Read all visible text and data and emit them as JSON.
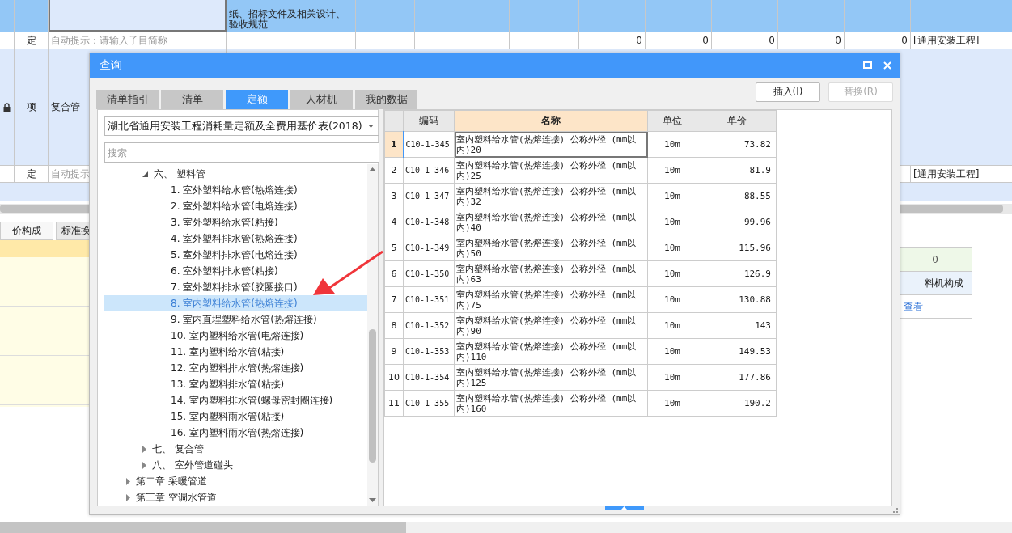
{
  "sheet": {
    "rows": [
      {
        "kind": "description",
        "selected": true,
        "text": "纸、招标文件及相关设计、验收规范"
      },
      {
        "kind": "sub",
        "type": "定",
        "placeholder": "自动提示：请输入子目简称",
        "values": [
          "0",
          "0",
          "0",
          "0",
          "0"
        ],
        "category": "[通用安装工程]"
      },
      {
        "kind": "item",
        "locked": true,
        "type": "项",
        "name": "复合管"
      },
      {
        "kind": "sub",
        "type": "定",
        "placeholder": "自动提示",
        "category": "[通用安装工程]"
      },
      {
        "kind": "blank"
      }
    ]
  },
  "lower_tabs": [
    {
      "label": "价构成",
      "selected": true
    },
    {
      "label": "标准换",
      "selected": false
    }
  ],
  "side_box": {
    "value": "0",
    "header": "料机构成",
    "link": "查看"
  },
  "dialog": {
    "title": "查询",
    "tabs": [
      {
        "label": "清单指引",
        "selected": false
      },
      {
        "label": "清单",
        "selected": false
      },
      {
        "label": "定额",
        "selected": true
      },
      {
        "label": "人材机",
        "selected": false
      },
      {
        "label": "我的数据",
        "selected": false
      }
    ],
    "buttons": [
      {
        "label": "插入(I)",
        "disabled": false
      },
      {
        "label": "替换(R)",
        "disabled": true
      }
    ],
    "library": "湖北省通用安装工程消耗量定额及全费用基价表(2018)",
    "search": {
      "placeholder": "搜索"
    },
    "tree": [
      {
        "children": [
          {
            "label": "六、 塑料管",
            "expanded": true,
            "selected": false,
            "children": [
              {
                "label": "1. 室外塑料给水管(热熔连接)",
                "selected": false
              },
              {
                "label": "2. 室外塑料给水管(电熔连接)",
                "selected": false
              },
              {
                "label": "3. 室外塑料给水管(粘接)",
                "selected": false
              },
              {
                "label": "4. 室外塑料排水管(热熔连接)",
                "selected": false
              },
              {
                "label": "5. 室外塑料排水管(电熔连接)",
                "selected": false
              },
              {
                "label": "6. 室外塑料排水管(粘接)",
                "selected": false
              },
              {
                "label": "7. 室外塑料排水管(胶圈接口)",
                "selected": false
              },
              {
                "label": "8. 室内塑料给水管(热熔连接)",
                "selected": true
              },
              {
                "label": "9. 室内直埋塑料给水管(热熔连接)",
                "selected": false
              },
              {
                "label": "10. 室内塑料给水管(电熔连接)",
                "selected": false
              },
              {
                "label": "11. 室内塑料给水管(粘接)",
                "selected": false
              },
              {
                "label": "12. 室内塑料排水管(热熔连接)",
                "selected": false
              },
              {
                "label": "13. 室内塑料排水管(粘接)",
                "selected": false
              },
              {
                "label": "14. 室内塑料排水管(螺母密封圈连接)",
                "selected": false
              },
              {
                "label": "15. 室内塑料雨水管(粘接)",
                "selected": false
              },
              {
                "label": "16. 室内塑料雨水管(热熔连接)",
                "selected": false
              }
            ]
          },
          {
            "label": "七、 复合管",
            "expanded": false,
            "selected": false
          },
          {
            "label": "八、 室外管道碰头",
            "expanded": false,
            "selected": false
          }
        ]
      },
      {
        "label": "第二章 采暖管道",
        "expanded": false,
        "selected": false
      },
      {
        "label": "第三章 空调水管道",
        "expanded": false,
        "selected": false
      }
    ],
    "table": {
      "columns": [
        "编码",
        "名称",
        "单位",
        "单价"
      ],
      "rows": [
        {
          "index": "1",
          "code": "C10-1-345",
          "name": "室内塑料给水管(热熔连接) 公称外径 (mm以内)20",
          "unit": "10m",
          "price": "73.82",
          "selected": true
        },
        {
          "index": "2",
          "code": "C10-1-346",
          "name": "室内塑料给水管(热熔连接) 公称外径 (mm以内)25",
          "unit": "10m",
          "price": "81.9",
          "selected": false
        },
        {
          "index": "3",
          "code": "C10-1-347",
          "name": "室内塑料给水管(热熔连接) 公称外径 (mm以内)32",
          "unit": "10m",
          "price": "88.55",
          "selected": false
        },
        {
          "index": "4",
          "code": "C10-1-348",
          "name": "室内塑料给水管(热熔连接) 公称外径 (mm以内)40",
          "unit": "10m",
          "price": "99.96",
          "selected": false
        },
        {
          "index": "5",
          "code": "C10-1-349",
          "name": "室内塑料给水管(热熔连接) 公称外径 (mm以内)50",
          "unit": "10m",
          "price": "115.96",
          "selected": false
        },
        {
          "index": "6",
          "code": "C10-1-350",
          "name": "室内塑料给水管(热熔连接) 公称外径 (mm以内)63",
          "unit": "10m",
          "price": "126.9",
          "selected": false
        },
        {
          "index": "7",
          "code": "C10-1-351",
          "name": "室内塑料给水管(热熔连接) 公称外径 (mm以内)75",
          "unit": "10m",
          "price": "130.88",
          "selected": false
        },
        {
          "index": "8",
          "code": "C10-1-352",
          "name": "室内塑料给水管(热熔连接) 公称外径 (mm以内)90",
          "unit": "10m",
          "price": "143",
          "selected": false
        },
        {
          "index": "9",
          "code": "C10-1-353",
          "name": "室内塑料给水管(热熔连接) 公称外径 (mm以内)110",
          "unit": "10m",
          "price": "149.53",
          "selected": false
        },
        {
          "index": "10",
          "code": "C10-1-354",
          "name": "室内塑料给水管(热熔连接) 公称外径 (mm以内)125",
          "unit": "10m",
          "price": "177.86",
          "selected": false
        },
        {
          "index": "11",
          "code": "C10-1-355",
          "name": "室内塑料给水管(热熔连接) 公称外径 (mm以内)160",
          "unit": "10m",
          "price": "190.2",
          "selected": false
        }
      ]
    }
  }
}
